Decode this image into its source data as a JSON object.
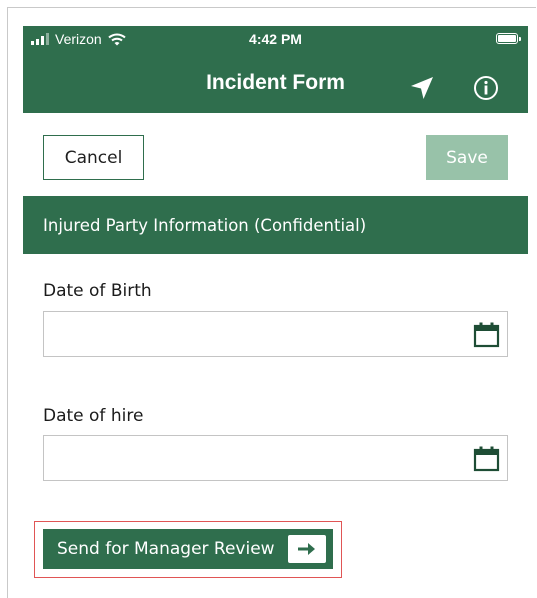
{
  "status_bar": {
    "carrier": "Verizon",
    "time": "4:42 PM"
  },
  "header": {
    "title": "Incident Form",
    "nav_icon": "location-arrow-icon",
    "info_icon": "info-icon"
  },
  "actions": {
    "cancel_label": "Cancel",
    "save_label": "Save"
  },
  "section": {
    "title": "Injured Party Information (Confidential)"
  },
  "fields": [
    {
      "label": "Date of Birth",
      "value": "",
      "icon": "calendar-icon"
    },
    {
      "label": "Date of hire",
      "value": "",
      "icon": "calendar-icon"
    }
  ],
  "review_button": {
    "label": "Send for Manager Review",
    "icon": "arrow-right-icon"
  },
  "colors": {
    "primary": "#2f6e4d",
    "save_disabled": "#98c2a9",
    "highlight": "#e05555",
    "input_border": "#c4c4c4"
  }
}
